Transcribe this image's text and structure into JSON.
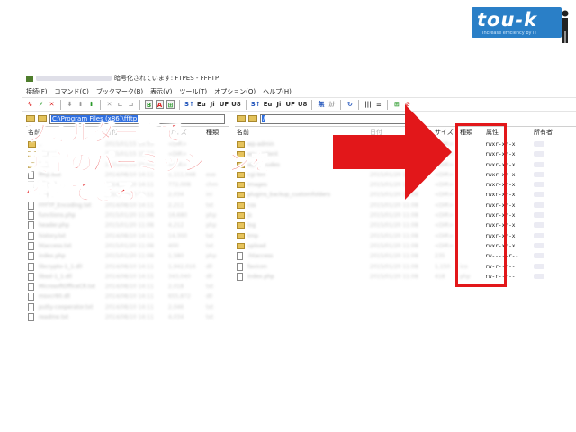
{
  "logo": {
    "text": "tou-k",
    "tagline": "Increase efficiency by IT"
  },
  "window": {
    "title": "暗号化されています: FTPES - FFFTP",
    "menu": [
      "接続(F)",
      "コマンド(C)",
      "ブックマーク(B)",
      "表示(V)",
      "ツール(T)",
      "オプション(O)",
      "ヘルプ(H)"
    ],
    "toolbar": [
      "↯",
      "⚡",
      "✕",
      "⬇",
      "⬆",
      "⬆",
      "✕",
      "⊏",
      "⊐",
      "B",
      "A",
      "⊞",
      "S↑",
      "Eu",
      "Ji",
      "UF",
      "U8",
      "S↑",
      "Eu",
      "Ji",
      "UF",
      "U8",
      "無",
      "ｶﾅ",
      "↻",
      "|||",
      "≡",
      "⊞",
      "⊘"
    ]
  },
  "local": {
    "path": "C:\\Program Files (x86)\\ffftp",
    "columns": {
      "name": "名前",
      "date": "日付",
      "size": "サイズ",
      "type": "種類"
    },
    "rows": [
      {
        "icon": "folder-icon",
        "name": "..",
        "date": "2015/01/15 15:53",
        "size": "<DIR>",
        "type": ""
      },
      {
        "icon": "folder-icon",
        "name": "Manual",
        "date": "2015/01/15 15:53",
        "size": "<DIR>",
        "type": ""
      },
      {
        "icon": "folder-icon",
        "name": "SSL",
        "date": "2015/01/15 15:53",
        "size": "<DIR>",
        "type": ""
      },
      {
        "icon": "file-icon",
        "name": "ffftp.exe",
        "date": "2014/08/10 14:11",
        "size": "1,111,048",
        "type": "exe"
      },
      {
        "icon": "file-icon",
        "name": "ffftp.chm",
        "date": "2014/08/10 14:11",
        "size": "772,008",
        "type": "chm"
      },
      {
        "icon": "file-icon",
        "name": "ffftp.ini",
        "date": "2014/08/10 14:11",
        "size": "2,034",
        "type": "ini"
      },
      {
        "icon": "file-icon",
        "name": "FFFTP_Encoding.txt",
        "date": "2014/08/10 14:11",
        "size": "2,211",
        "type": "txt"
      },
      {
        "icon": "file-icon",
        "name": "functions.php",
        "date": "2015/01/20 11:08",
        "size": "16,680",
        "type": "php"
      },
      {
        "icon": "file-icon",
        "name": "header.php",
        "date": "2015/01/20 11:08",
        "size": "4,212",
        "type": "php"
      },
      {
        "icon": "file-icon",
        "name": "history.txt",
        "date": "2014/08/10 14:11",
        "size": "14,300",
        "type": "txt"
      },
      {
        "icon": "file-icon",
        "name": "htaccess.txt",
        "date": "2015/01/20 11:08",
        "size": "400",
        "type": "txt"
      },
      {
        "icon": "file-icon",
        "name": "index.php",
        "date": "2015/01/20 11:08",
        "size": "1,580",
        "type": "php"
      },
      {
        "icon": "file-icon",
        "name": "libcrypto-1_1.dll",
        "date": "2014/08/10 14:11",
        "size": "1,942,016",
        "type": "dll"
      },
      {
        "icon": "file-icon",
        "name": "libssl-1_1.dll",
        "date": "2014/08/10 14:11",
        "size": "343,040",
        "type": "dll"
      },
      {
        "icon": "file-icon",
        "name": "MicrosoftOfficeCR.txt",
        "date": "2014/08/10 14:11",
        "size": "2,018",
        "type": "txt"
      },
      {
        "icon": "file-icon",
        "name": "msvcr90.dll",
        "date": "2014/08/10 14:11",
        "size": "655,872",
        "type": "dll"
      },
      {
        "icon": "file-icon",
        "name": "putty-cooperator.txt",
        "date": "2014/08/10 14:11",
        "size": "2,046",
        "type": "txt"
      },
      {
        "icon": "file-icon",
        "name": "readme.txt",
        "date": "2014/08/10 14:11",
        "size": "4,034",
        "type": "txt"
      }
    ]
  },
  "remote": {
    "path": "/",
    "columns": {
      "name": "名前",
      "date": "日付",
      "size": "サイズ",
      "type": "種類",
      "attr": "属性",
      "owner": "所有者"
    },
    "rows": [
      {
        "icon": "folder-icon",
        "name": "wp-admin",
        "date": "2015/01/20 11:08",
        "size": "<DIR>",
        "type": "",
        "attr": "rwxr-xr-x"
      },
      {
        "icon": "folder-icon",
        "name": "wp-content",
        "date": "2015/01/20 11:08",
        "size": "<DIR>",
        "type": "",
        "attr": "rwxr-xr-x"
      },
      {
        "icon": "folder-icon",
        "name": "wp-includes",
        "date": "2015/01/20 11:08",
        "size": "<DIR>",
        "type": "",
        "attr": "rwxr-xr-x"
      },
      {
        "icon": "folder-icon",
        "name": "cgi-bin",
        "date": "2015/01/20 11:08",
        "size": "<DIR>",
        "type": "",
        "attr": "rwxr-xr-x"
      },
      {
        "icon": "folder-icon",
        "name": "images",
        "date": "2015/01/20 11:08",
        "size": "<DIR>",
        "type": "",
        "attr": "rwxr-xr-x"
      },
      {
        "icon": "folder-icon",
        "name": "plugins_backup_customfolders",
        "date": "2015/01/20 11:08",
        "size": "<DIR>",
        "type": "",
        "attr": "rwxr-xr-x"
      },
      {
        "icon": "folder-icon",
        "name": "css",
        "date": "2015/01/20 11:08",
        "size": "<DIR>",
        "type": "",
        "attr": "rwxr-xr-x"
      },
      {
        "icon": "folder-icon",
        "name": "js",
        "date": "2015/01/20 11:08",
        "size": "<DIR>",
        "type": "",
        "attr": "rwxr-xr-x"
      },
      {
        "icon": "folder-icon",
        "name": "log",
        "date": "2015/01/20 11:08",
        "size": "<DIR>",
        "type": "",
        "attr": "rwxr-xr-x"
      },
      {
        "icon": "folder-icon",
        "name": "tmp",
        "date": "2015/01/20 11:08",
        "size": "<DIR>",
        "type": "",
        "attr": "rwxr-xr-x"
      },
      {
        "icon": "folder-icon",
        "name": "upload",
        "date": "2015/01/20 11:08",
        "size": "<DIR>",
        "type": "",
        "attr": "rwxr-xr-x"
      },
      {
        "icon": "file-icon",
        "name": ".htaccess",
        "date": "2015/01/20 11:08",
        "size": "235",
        "type": "",
        "attr": "rw-----r--"
      },
      {
        "icon": "file-icon",
        "name": "favicon",
        "date": "2015/01/20 11:08",
        "size": "1,150",
        "type": "ico",
        "attr": "rw-r--r--"
      },
      {
        "icon": "file-icon",
        "name": "index.php",
        "date": "2015/01/20 11:08",
        "size": "418",
        "type": "php",
        "attr": "rw-r--r--"
      }
    ]
  },
  "overlay": {
    "caption": "フォルダ一覧で\n英字のパーミッションを\n確認できる。",
    "accent": "#e2171a"
  }
}
